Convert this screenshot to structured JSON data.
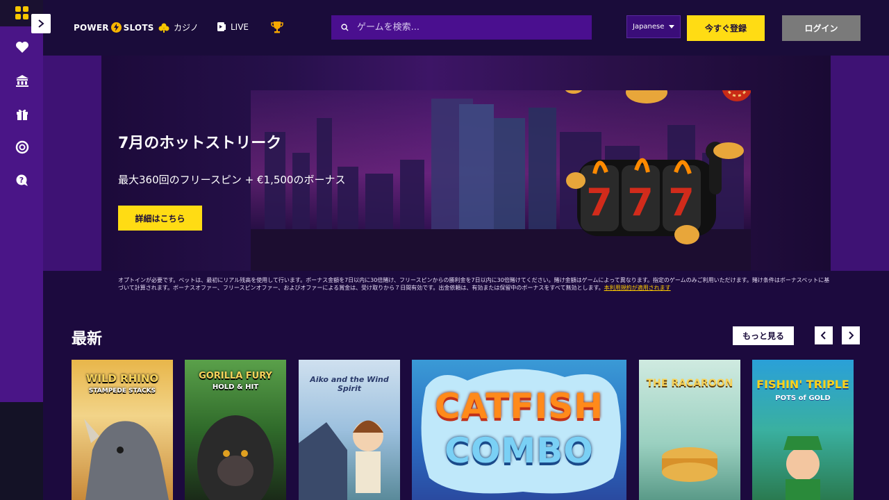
{
  "header": {
    "brand_left": "POWER",
    "brand_right": "SLOTS",
    "nav": [
      {
        "label": "カジノ",
        "icon": "clover-icon"
      },
      {
        "label": "LIVE",
        "icon": "live-cards-icon"
      },
      {
        "label": "",
        "icon": "trophy-icon"
      }
    ],
    "search_placeholder": "ゲームを検索...",
    "language": "Japanese",
    "register_label": "今すぐ登録",
    "login_label": "ログイン"
  },
  "sidebar": {
    "icons": [
      "heart-icon",
      "bank-icon",
      "gift-icon",
      "target-icon",
      "help-chat-icon"
    ]
  },
  "hero": {
    "title": "7月のホットストリーク",
    "subtitle": "最大360回のフリースピン + €1,500のボーナス",
    "cta_label": "詳細はこちら"
  },
  "terms": {
    "text": "オプトインが必要です。ベットは、最初にリアル残高を使用して行います。ボーナス金額を7日以内に30倍賭け、フリースピンからの勝利金を7日以内に30倍賭けてください。賭け金額はゲームによって異なります。指定のゲームのみご利用いただけます。賭け条件はボーナスベットに基づいて計算されます。ボーナスオファー、フリースピンオファー、およびオファーによる賞金は、受け取りから７日間有効です。出金依頼は、有効または保留中のボーナスをすべて無効とします。",
    "link": "本利用規約が適用されます"
  },
  "section": {
    "title": "最新",
    "more_label": "もっと見る"
  },
  "games": [
    {
      "name": "WILD RHINO",
      "sub": "STAMPEDE STACKS"
    },
    {
      "name": "GORILLA FURY",
      "sub": "HOLD & HIT"
    },
    {
      "name": "Aiko and the Wind Spirit",
      "sub": ""
    },
    {
      "name": "CATFISH",
      "sub": "COMBO"
    },
    {
      "name": "THE RACAROON",
      "sub": ""
    },
    {
      "name": "FISHIN' TRIPLE",
      "sub": "POTS of GOLD"
    }
  ]
}
